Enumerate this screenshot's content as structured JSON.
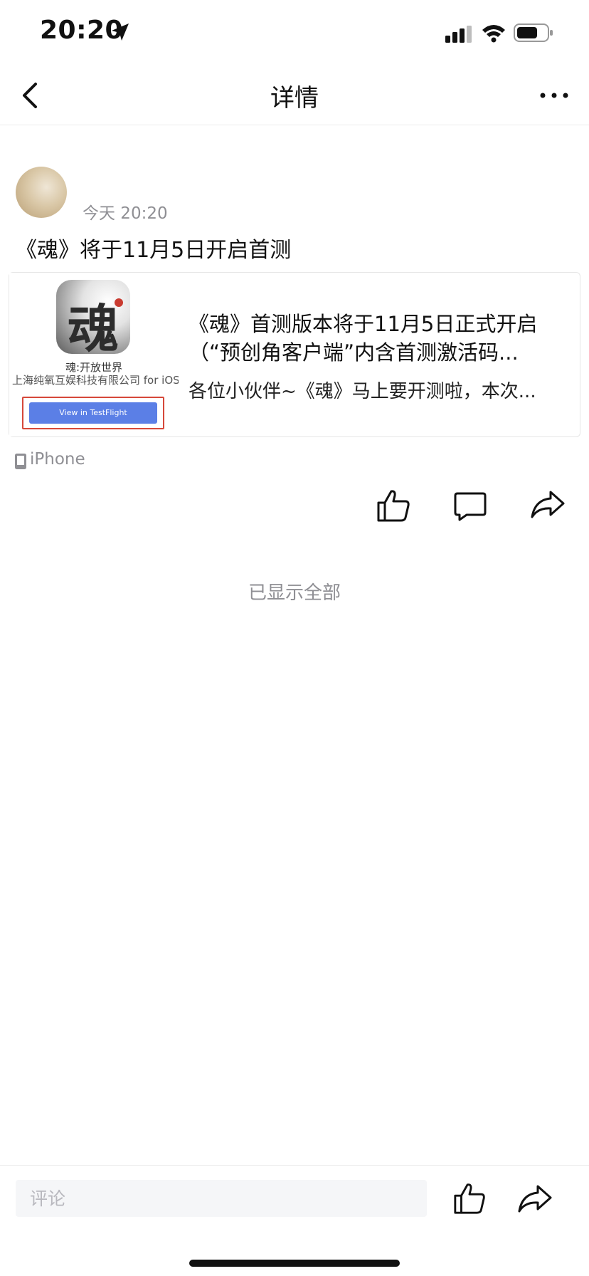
{
  "status_bar": {
    "time": "20:20",
    "icons": [
      "location-arrow-icon",
      "signal-icon",
      "wifi-icon",
      "battery-icon"
    ]
  },
  "nav": {
    "title": "详情",
    "icons": [
      "back-chevron-icon",
      "more-dots-icon"
    ]
  },
  "post": {
    "time": "今天 20:20",
    "text": "《魂》将于11月5日开启首测",
    "link_card": {
      "app_icon_glyph": "魂",
      "app_name": "魂:开放世界",
      "app_company": "上海纯氧互娱科技有限公司 for iOS",
      "testflight_button": "View in TestFlight",
      "title": "《魂》首测版本将于11月5日正式开启（“预创角客户端”内含首测激活码...",
      "description": "各位小伙伴~《魂》马上要开测啦，本次..."
    },
    "device": "iPhone",
    "actions": [
      "like-icon",
      "comment-icon",
      "share-icon"
    ]
  },
  "feed_end_text": "已显示全部",
  "bottom_bar": {
    "comment_placeholder": "评论",
    "icons": [
      "like-icon",
      "share-icon"
    ]
  },
  "colors": {
    "accent_button": "#5b7fe6",
    "highlight_frame": "#d6483a",
    "secondary_text": "#8f8f94",
    "input_bg": "#f5f6f8"
  }
}
